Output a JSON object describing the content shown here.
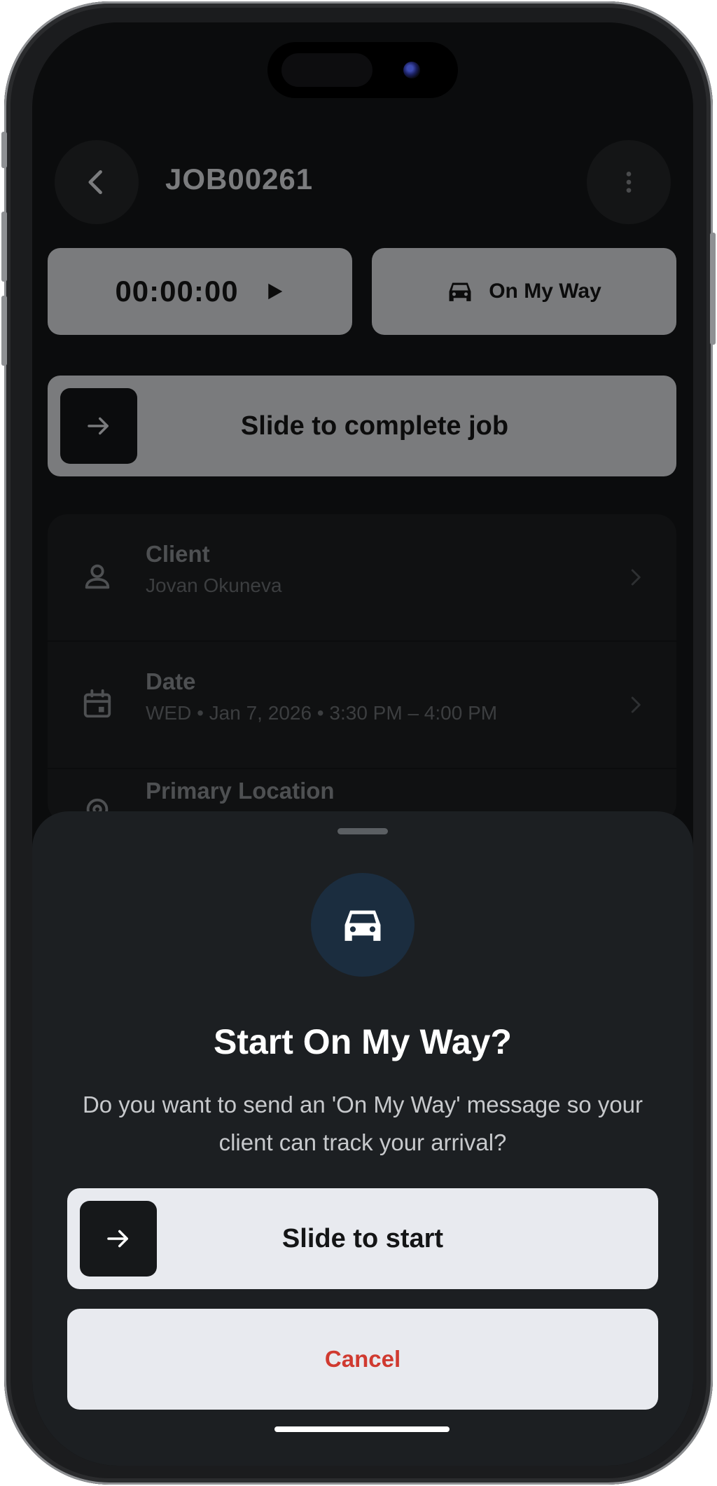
{
  "header": {
    "job_id": "JOB00261"
  },
  "actions": {
    "timer": "00:00:00",
    "on_my_way": "On My Way",
    "slide_complete": "Slide to complete job"
  },
  "details": {
    "client_label": "Client",
    "client_value": "Jovan Okuneva",
    "date_label": "Date",
    "date_value": "WED • Jan 7, 2026 • 3:30 PM – 4:00 PM",
    "location_label": "Primary Location"
  },
  "sheet": {
    "title": "Start On My Way?",
    "message": "Do you want to send an 'On My Way' message so your client can track your arrival?",
    "slide_start": "Slide to start",
    "cancel": "Cancel"
  },
  "icons": {
    "back": "chevron-left-icon",
    "more": "more-vertical-icon",
    "play": "play-icon",
    "car": "car-icon",
    "arrow": "arrow-right-icon",
    "person": "person-icon",
    "calendar": "calendar-icon",
    "location": "location-pin-icon",
    "chevron": "chevron-right-icon"
  },
  "colors": {
    "sheet_bg": "#1c1f22",
    "icon_circle": "#1b2d3f",
    "cancel_text": "#d03a30",
    "button_bg": "#e8eaef"
  }
}
